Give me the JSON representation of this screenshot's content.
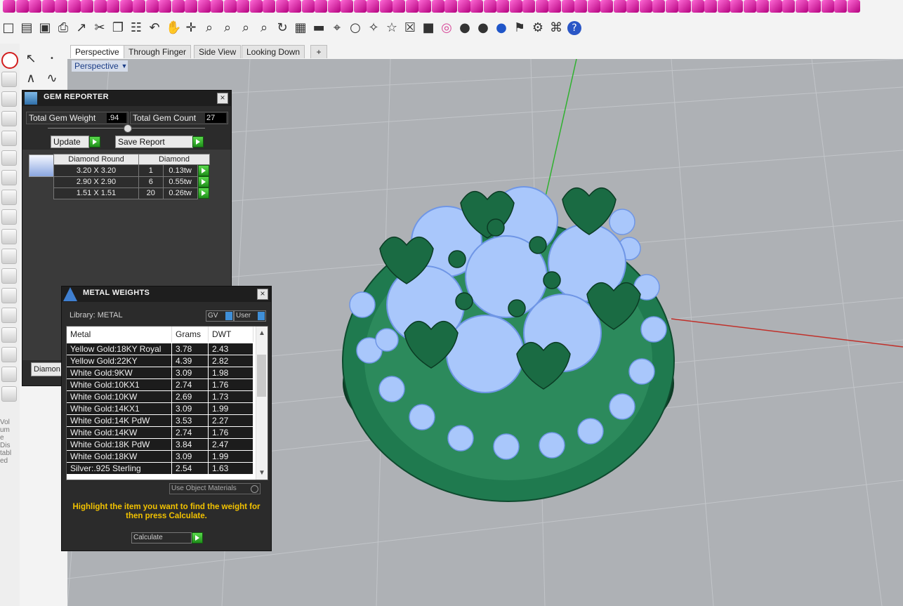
{
  "toolbar": {
    "top_icons": [
      "pink-shape-icon"
    ],
    "standard": [
      "new-file-icon",
      "open-file-icon",
      "save-icon",
      "print-icon",
      "export-icon",
      "cut-icon",
      "copy-icon",
      "paste-icon",
      "undo-icon",
      "pan-hand-icon",
      "rotate-view-icon",
      "zoom-icon",
      "zoom-window-icon",
      "zoom-extents-icon",
      "zoom-selected-icon",
      "rotate-icon",
      "grid-viewports-icon",
      "car-icon",
      "snap-icon",
      "clock-icon",
      "magic-wand-icon",
      "lightbulb-icon",
      "lock-icon",
      "render-icon",
      "color-wheel-icon",
      "sphere-icon",
      "gray-sphere-icon",
      "blue-sphere-icon",
      "flag-icon",
      "gear-settings-icon",
      "crop-icon",
      "help-icon"
    ]
  },
  "left_toolbar": {
    "labels": [
      "Vol",
      "um",
      "e",
      "Dis",
      "tabl",
      "ed"
    ]
  },
  "tabs": [
    "Perspective",
    "Through Finger",
    "Side View",
    "Looking Down",
    "+"
  ],
  "viewport": {
    "label": "Perspective"
  },
  "gem_reporter": {
    "title": "GEM REPORTER",
    "total_weight_label": "Total Gem Weight",
    "total_weight_value": ".94",
    "total_count_label": "Total Gem Count",
    "total_count_value": "27",
    "update_label": "Update",
    "save_report_label": "Save Report",
    "table_header": [
      "Diamond Round",
      "Diamond"
    ],
    "rows": [
      {
        "size": "3.20 X 3.20",
        "count": "1",
        "weight": "0.13tw"
      },
      {
        "size": "2.90 X 2.90",
        "count": "6",
        "weight": "0.55tw"
      },
      {
        "size": "1.51 X 1.51",
        "count": "20",
        "weight": "0.26tw"
      }
    ],
    "bottom_tab": "Diamon"
  },
  "metal_weights": {
    "title": "METAL WEIGHTS",
    "library_label": "Library: METAL",
    "gv_label": "GV",
    "user_label": "User",
    "headers": [
      "Metal",
      "Grams",
      "DWT"
    ],
    "rows": [
      {
        "metal": "Yellow Gold:18KY Royal",
        "grams": "3.78",
        "dwt": "2.43"
      },
      {
        "metal": "Yellow Gold:22KY",
        "grams": "4.39",
        "dwt": "2.82"
      },
      {
        "metal": "White Gold:9KW",
        "grams": "3.09",
        "dwt": "1.98"
      },
      {
        "metal": "White Gold:10KX1",
        "grams": "2.74",
        "dwt": "1.76"
      },
      {
        "metal": "White Gold:10KW",
        "grams": "2.69",
        "dwt": "1.73"
      },
      {
        "metal": "White Gold:14KX1",
        "grams": "3.09",
        "dwt": "1.99"
      },
      {
        "metal": "White Gold:14K PdW",
        "grams": "3.53",
        "dwt": "2.27"
      },
      {
        "metal": "White Gold:14KW",
        "grams": "2.74",
        "dwt": "1.76"
      },
      {
        "metal": "White Gold:18K PdW",
        "grams": "3.84",
        "dwt": "2.47"
      },
      {
        "metal": "White Gold:18KW",
        "grams": "3.09",
        "dwt": "1.99"
      },
      {
        "metal": "Silver:.925 Sterling",
        "grams": "2.54",
        "dwt": "1.63"
      }
    ],
    "use_object_materials": "Use Object Materials",
    "instruction": "Highlight the item you want to find the weight for then press Calculate.",
    "calculate_label": "Calculate"
  },
  "colors": {
    "viewport_bg": "#aeb1b5",
    "grid": "#c3c6ca",
    "metal_green": "#1f7a4f",
    "gem_blue": "#9fbff7",
    "instruction_text": "#f2c200",
    "action_green": "#2eb82a"
  }
}
